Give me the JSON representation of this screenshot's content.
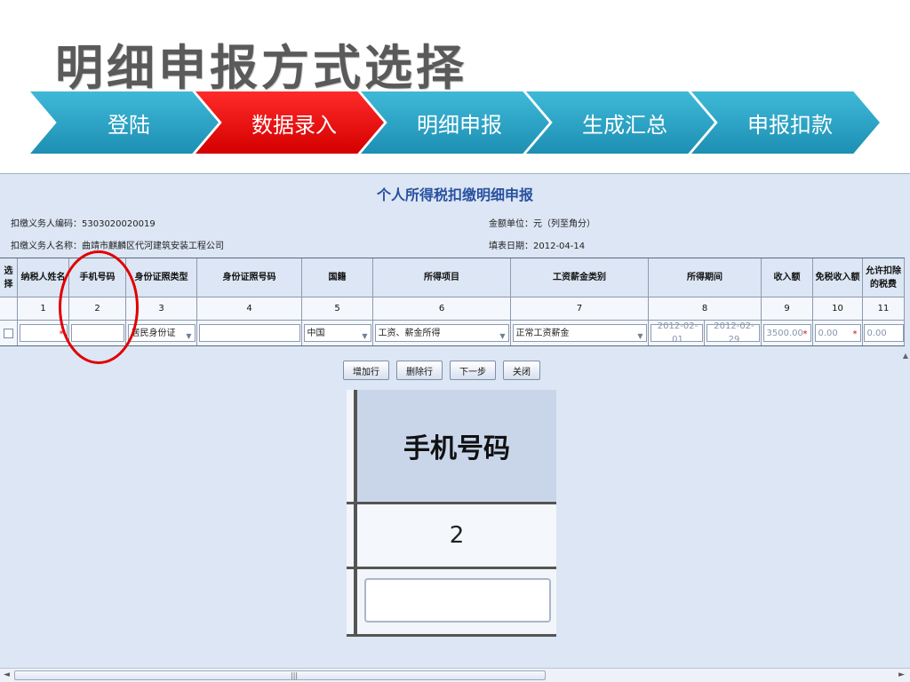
{
  "slide": {
    "title": "明细申报方式选择"
  },
  "steps": [
    {
      "label": "登陆",
      "active": false
    },
    {
      "label": "数据录入",
      "active": true
    },
    {
      "label": "明细申报",
      "active": false
    },
    {
      "label": "生成汇总",
      "active": false
    },
    {
      "label": "申报扣款",
      "active": false
    }
  ],
  "form": {
    "title": "个人所得税扣缴明细申报",
    "withholder_code": "扣缴义务人编码：5303020020019",
    "withholder_name": "扣缴义务人名称：曲靖市麒麟区代河建筑安装工程公司",
    "amount_unit": "金额单位：元（列至角分）",
    "fill_date": "填表日期：2012-04-14"
  },
  "table": {
    "headers": [
      "选择",
      "纳税人姓名",
      "手机号码",
      "身份证照类型",
      "身份证照号码",
      "国籍",
      "所得项目",
      "工资薪金类别",
      "所得期间",
      "收入额",
      "免税收入额",
      "允许扣除的税费"
    ],
    "numbers": [
      "1",
      "2",
      "3",
      "4",
      "5",
      "6",
      "7",
      "8",
      "9",
      "10",
      "11"
    ],
    "row": {
      "id_type": "居民身份证",
      "nationality": "中国",
      "income_item": "工资、薪金所得",
      "salary_category": "正常工资薪金",
      "period_start": "2012-02-01",
      "period_end": "2012-02-29",
      "income": "3500.00",
      "tax_free": "0.00",
      "deductible": "0.00"
    }
  },
  "buttons": {
    "add_row": "增加行",
    "delete_row": "删除行",
    "next": "下一步",
    "close": "关闭"
  },
  "zoom": {
    "header": "手机号码",
    "number": "2"
  },
  "colors": {
    "active_step": "#e00000",
    "step": "#2aa6cc",
    "highlight": "#e00000"
  }
}
